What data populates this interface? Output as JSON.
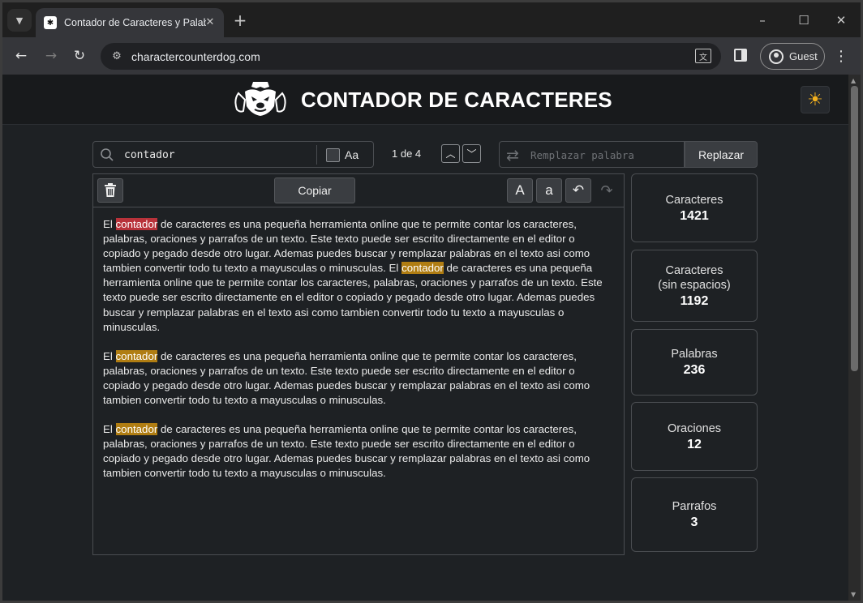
{
  "browser": {
    "tab_title": "Contador de Caracteres y Palabras",
    "url": "charactercounterdog.com",
    "profile_label": "Guest",
    "icons": [
      "tab-search-icon",
      "close-icon",
      "plus-icon",
      "minimize-icon",
      "maximize-icon",
      "close-window-icon",
      "back-arrow-icon",
      "forward-arrow-icon",
      "reload-icon",
      "site-info-icon",
      "translate-icon",
      "side-panel-icon",
      "profile-icon",
      "more-vert-icon"
    ]
  },
  "header": {
    "title": "CONTADOR DE CARACTERES",
    "theme_icon": "sun-icon"
  },
  "search": {
    "value": "contador",
    "case_label": "Aa",
    "match_count": "1 de 4"
  },
  "replace": {
    "placeholder": "Remplazar palabra",
    "button_label": "Replazar"
  },
  "editor": {
    "copy_label": "Copiar",
    "upper_label": "A",
    "lower_label": "a",
    "paragraphs": [
      [
        {
          "t": "El ",
          "h": ""
        },
        {
          "t": "contador",
          "h": "current"
        },
        {
          "t": " de caracteres es una pequeña herramienta online que te permite contar los caracteres, palabras, oraciones y parrafos de un texto. Este texto puede ser escrito directamente en el editor o copiado y pegado desde otro lugar. Ademas puedes buscar y remplazar palabras en el texto asi como tambien convertir todo tu texto a mayusculas o minusculas. El ",
          "h": ""
        },
        {
          "t": "contador",
          "h": "match"
        },
        {
          "t": " de caracteres es una pequeña herramienta online que te permite contar los caracteres, palabras, oraciones y parrafos de un texto. Este texto puede ser escrito directamente en el editor o copiado y pegado desde otro lugar. Ademas puedes buscar y remplazar palabras en el texto asi como tambien convertir todo tu texto a mayusculas o minusculas.",
          "h": ""
        }
      ],
      [
        {
          "t": "El ",
          "h": ""
        },
        {
          "t": "contador",
          "h": "match"
        },
        {
          "t": " de caracteres es una pequeña herramienta online que te permite contar los caracteres, palabras, oraciones y parrafos de un texto. Este texto puede ser escrito directamente en el editor o copiado y pegado desde otro lugar. Ademas puedes buscar y remplazar palabras en el texto asi como tambien convertir todo tu texto a mayusculas o minusculas.",
          "h": ""
        }
      ],
      [
        {
          "t": "El ",
          "h": ""
        },
        {
          "t": "contador",
          "h": "match"
        },
        {
          "t": " de caracteres es una pequeña herramienta online que te permite contar los caracteres, palabras, oraciones y parrafos de un texto. Este texto puede ser escrito directamente en el editor o copiado y pegado desde otro lugar. Ademas puedes buscar y remplazar palabras en el texto asi como tambien convertir todo tu texto a mayusculas o minusculas.",
          "h": ""
        }
      ]
    ]
  },
  "stats": [
    {
      "label": "Caracteres",
      "value": "1421"
    },
    {
      "label": "Caracteres\n(sin espacios)",
      "value": "1192"
    },
    {
      "label": "Palabras",
      "value": "236"
    },
    {
      "label": "Oraciones",
      "value": "12"
    },
    {
      "label": "Parrafos",
      "value": "3"
    }
  ],
  "colors": {
    "current_match": "#b8323a",
    "match": "#b07d12",
    "accent_sun": "#f2b01e"
  }
}
